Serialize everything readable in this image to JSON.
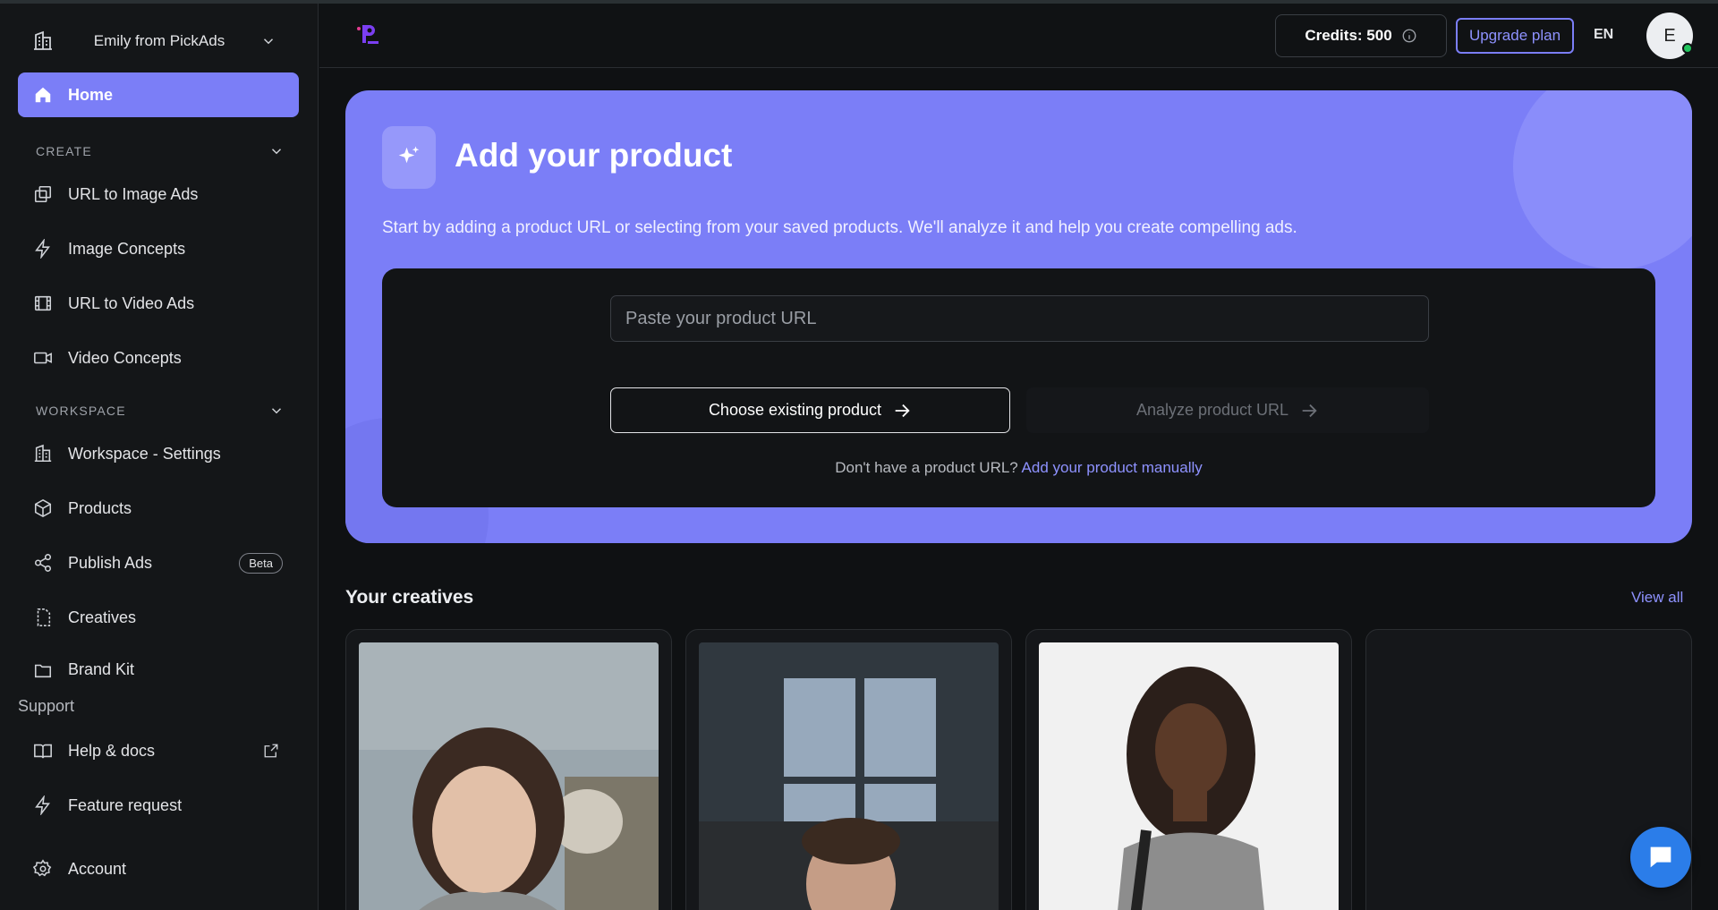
{
  "sidebar": {
    "workspace_name": "Emily from PickAds",
    "home_label": "Home",
    "create_section": "CREATE",
    "create_items": [
      {
        "label": "URL to Image Ads",
        "icon": "copy-icon"
      },
      {
        "label": "Image Concepts",
        "icon": "bolt-icon"
      },
      {
        "label": "URL to Video Ads",
        "icon": "film-icon"
      },
      {
        "label": "Video Concepts",
        "icon": "video-camera-icon"
      }
    ],
    "workspace_section": "WORKSPACE",
    "workspace_items": [
      {
        "label": "Workspace - Settings",
        "icon": "building-icon"
      },
      {
        "label": "Products",
        "icon": "box-icon"
      },
      {
        "label": "Publish Ads",
        "icon": "share-icon",
        "badge": "Beta"
      },
      {
        "label": "Creatives",
        "icon": "file-dashed-icon"
      },
      {
        "label": "Brand Kit",
        "icon": "folder-icon"
      }
    ],
    "support_label": "Support",
    "support_items": [
      {
        "label": "Help & docs",
        "icon": "book-icon"
      },
      {
        "label": "Feature request",
        "icon": "bolt-icon"
      },
      {
        "label": "Account",
        "icon": "gear-icon"
      }
    ]
  },
  "topbar": {
    "credits_label": "Credits: 500",
    "upgrade_label": "Upgrade plan",
    "language": "EN",
    "avatar_initial": "E"
  },
  "hero": {
    "title": "Add your product",
    "subtitle": "Start by adding a product URL or selecting from your saved products. We'll analyze it and help you create compelling ads.",
    "url_placeholder": "Paste your product URL",
    "choose_label": "Choose existing product",
    "analyze_label": "Analyze product URL",
    "hint_text": "Don't have a product URL?",
    "hint_link": "Add your product manually"
  },
  "creatives": {
    "title": "Your creatives",
    "view_all": "View all"
  },
  "colors": {
    "accent": "#7b7ef7",
    "background": "#0f1113",
    "sidebar": "#141618"
  }
}
